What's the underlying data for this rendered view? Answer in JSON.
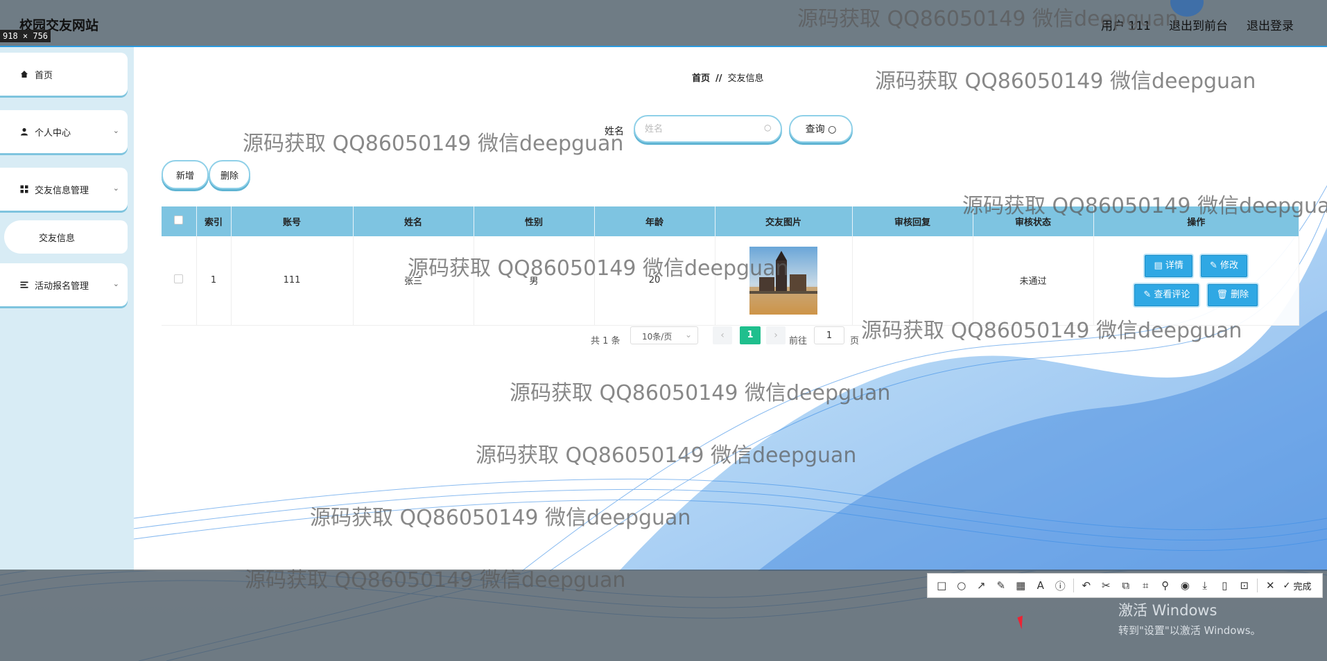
{
  "header": {
    "site_title": "校园交友网站",
    "user_label": "用户 111",
    "link_front": "退出到前台",
    "link_logout": "退出登录"
  },
  "capture": {
    "size_label": "918 × 756"
  },
  "sidebar": {
    "items": [
      {
        "label": "首页",
        "icon": "home-icon"
      },
      {
        "label": "个人中心",
        "icon": "user-icon"
      },
      {
        "label": "交友信息管理",
        "icon": "grid-icon"
      },
      {
        "label": "活动报名管理",
        "icon": "list-icon"
      }
    ],
    "sub_item": "交友信息"
  },
  "breadcrumb": {
    "home": "首页",
    "separator": "//",
    "current": "交友信息"
  },
  "search": {
    "label": "姓名",
    "placeholder": "姓名",
    "button": "查询"
  },
  "actions": {
    "add": "新增",
    "delete": "删除"
  },
  "table": {
    "headers": [
      "索引",
      "账号",
      "姓名",
      "性别",
      "年龄",
      "交友图片",
      "审核回复",
      "审核状态",
      "操作"
    ],
    "rows": [
      {
        "index": "1",
        "account": "111",
        "name": "张三",
        "gender": "男",
        "age": "20",
        "reply": "",
        "status": "未通过",
        "ops": [
          "详情",
          "修改",
          "查看评论",
          "删除"
        ]
      }
    ]
  },
  "pagination": {
    "total": "共 1 条",
    "page_size": "10条/页",
    "current_page": "1",
    "goto_prefix": "前往",
    "goto_value": "1",
    "goto_suffix": "页"
  },
  "watermark": "源码获取 QQ86050149 微信deepguan",
  "toolbar": {
    "done": "完成",
    "icons": [
      "rectangle-icon",
      "ellipse-icon",
      "arrow-icon",
      "pen-icon",
      "mosaic-icon",
      "text-icon",
      "number-icon",
      "undo-icon",
      "cut-icon",
      "translate-icon",
      "scan-icon",
      "pin-icon",
      "record-icon",
      "download-icon",
      "phone-icon",
      "bookmark-icon",
      "close-icon",
      "check-icon"
    ]
  },
  "windows": {
    "activate_title": "激活 Windows",
    "activate_hint": "转到\"设置\"以激活 Windows。"
  },
  "colors": {
    "accent": "#7ec4e1",
    "primary_button": "#2fa8e4",
    "page_active": "#1fbf8d"
  }
}
